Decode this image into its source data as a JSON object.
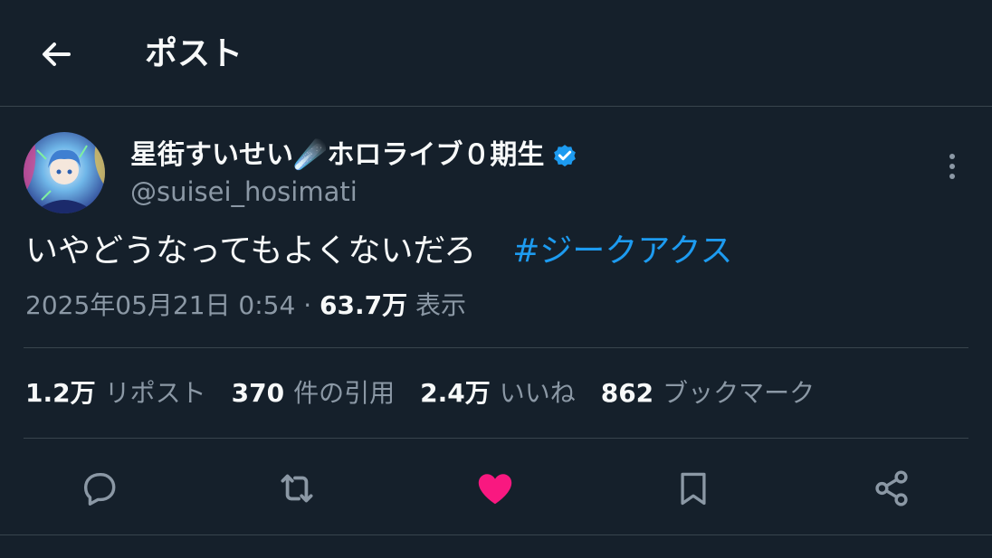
{
  "header": {
    "title": "ポスト"
  },
  "post": {
    "display_name": "星街すいせい☄️ホロライブ０期生",
    "handle": "@suisei_hosimati",
    "text": "いやどうなってもよくないだろ",
    "hashtag": "#ジークアクス",
    "timestamp": "2025年05月21日 0:54",
    "separator": "·",
    "views_count": "63.7万",
    "views_label": "表示"
  },
  "stats": {
    "reposts_count": "1.2万",
    "reposts_label": "リポスト",
    "quotes_count": "370",
    "quotes_label": "件の引用",
    "likes_count": "2.4万",
    "likes_label": "いいね",
    "bookmarks_count": "862",
    "bookmarks_label": "ブックマーク"
  },
  "colors": {
    "background": "#15202b",
    "text": "#f7f9f9",
    "secondary_text": "#8b98a5",
    "link": "#1d9bf0",
    "like": "#f91880",
    "verified": "#1d9bf0",
    "divider": "#38444d"
  },
  "icons": [
    "back-arrow-icon",
    "verified-badge-icon",
    "more-options-icon",
    "reply-icon",
    "repost-icon",
    "like-heart-icon",
    "bookmark-icon",
    "share-icon"
  ]
}
